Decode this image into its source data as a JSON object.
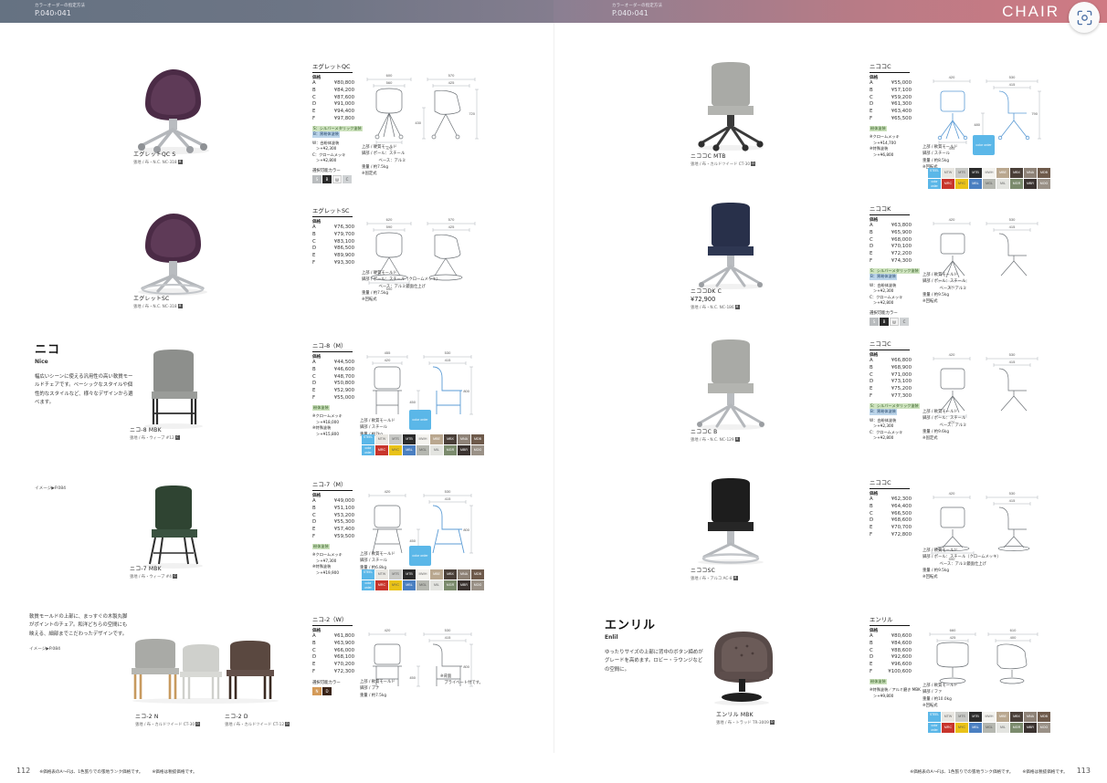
{
  "banner": {
    "left_note_small": "カラーオーダーの指定方法",
    "left_note_big": "P.040›041",
    "right_note_small": "カラーオーダーの指定方法",
    "right_note_big": "P.040›041",
    "category": "CHAIR",
    "camera_icon": "scan-camera-icon"
  },
  "labels": {
    "kakaku": "価格",
    "choose_color": "選択可能カラー",
    "joubu": "上部 /",
    "kyakubu": "脚部 /",
    "juuryou": "重量 /",
    "image_ref": "イメージ▶P.084"
  },
  "series": [
    {
      "name": "ニコ",
      "en": "Nice",
      "desc": "幅広いシーンに使える汎用性の高い軟質モールドチェアです。ベーシックなスタイルや個性的なスタイルなど、様々なデザインから選べます。"
    },
    {
      "name": "エンリル",
      "en": "Enlil",
      "desc": "ゆったりサイズの上部に背中のボタン締めがグレードを高めます。ロビー・ラウンジなどの空間に。"
    }
  ],
  "left_margin_note": {
    "text": "軟質モールドの上部に、まっすぐの木製丸脚がポイントのチェア。和洋どちらの空間にも映える、細部までこだわったデザインです。",
    "ref": "イメージ▶P.084"
  },
  "products": [
    {
      "id": "egret-qc",
      "title": "エグレットQC",
      "prices": [
        {
          "rank": "A",
          "value": "¥80,800"
        },
        {
          "rank": "B",
          "value": "¥84,200"
        },
        {
          "rank": "C",
          "value": "¥87,600"
        },
        {
          "rank": "D",
          "value": "¥91,000"
        },
        {
          "rank": "E",
          "value": "¥94,400"
        },
        {
          "rank": "F",
          "value": "¥97,800"
        }
      ],
      "tags": [
        {
          "text": "S：シルバーメタリック塗装",
          "kind": "green"
        },
        {
          "text": "B：黒粉体塗装",
          "kind": "blue"
        }
      ],
      "options": [
        {
          "label": "W：白粉体塗装",
          "add": "＞+¥2,300"
        },
        {
          "label": "C：クロームメッキ",
          "add": "＞+¥2,800"
        }
      ],
      "swatches": [
        {
          "code": "S",
          "color": "#b9bcbe"
        },
        {
          "code": "B",
          "color": "#2a2a2a"
        },
        {
          "code": "W",
          "color": "#f2f2f2",
          "dark": true
        },
        {
          "code": "C",
          "color": "#cfd2d4",
          "dark": true
        }
      ],
      "materials": [
        "上部 / 硬質モールド",
        "脚部 / ポール：スチール",
        "　　　　 ベース：アルミ",
        "重量 / 約7.5kg",
        "※固定式"
      ],
      "dims": {
        "w_out": "600",
        "w_in": "560",
        "d_out": "570",
        "d_in": "425",
        "base": "470",
        "h_total": "720",
        "h_seat": "430",
        "h_back": "90"
      }
    },
    {
      "id": "egret-sc",
      "title": "エグレットSC",
      "prices": [
        {
          "rank": "A",
          "value": "¥76,300"
        },
        {
          "rank": "B",
          "value": "¥79,700"
        },
        {
          "rank": "C",
          "value": "¥83,100"
        },
        {
          "rank": "D",
          "value": "¥86,500"
        },
        {
          "rank": "E",
          "value": "¥89,900"
        },
        {
          "rank": "F",
          "value": "¥93,300"
        }
      ],
      "tags": [],
      "options": [],
      "swatches": [],
      "materials": [
        "上部 / 硬質モールド",
        "脚部 / ポール：スチール（クロームメッキ）",
        "　　　　 ベース：アルミ鏡面仕上げ",
        "重量 / 約7.5kg",
        "※回転式"
      ],
      "dims": {
        "w_out": "620",
        "w_in": "590",
        "d_out": "570",
        "d_in": "425",
        "base": "590",
        "h_total": "720",
        "h_seat": "430",
        "h_back": "90"
      }
    },
    {
      "id": "nico-8m",
      "title": "ニコ-8（M）",
      "prices": [
        {
          "rank": "A",
          "value": "¥44,500"
        },
        {
          "rank": "B",
          "value": "¥46,600"
        },
        {
          "rank": "C",
          "value": "¥48,700"
        },
        {
          "rank": "D",
          "value": "¥50,800"
        },
        {
          "rank": "E",
          "value": "¥52,900"
        },
        {
          "rank": "F",
          "value": "¥55,000"
        }
      ],
      "tags": [
        {
          "text": "粉体塗装",
          "kind": "green"
        }
      ],
      "options": [
        {
          "label": "※クロームメッキ",
          "add": "＞+¥18,000"
        },
        {
          "label": "※特殊塗装",
          "add": "＞+¥15,800"
        }
      ],
      "swatches": [],
      "materials": [
        "上部 / 軟質モールド",
        "脚部 / スチール",
        "重量 / 約7kg"
      ],
      "dims": {
        "w_out": "455",
        "w_in": "420",
        "d_out": "530",
        "d_in": "415",
        "base": "",
        "h_total": "800",
        "h_seat": "450",
        "h_back": ""
      },
      "has_palette": true
    },
    {
      "id": "nico-7m",
      "title": "ニコ-7（M）",
      "prices": [
        {
          "rank": "A",
          "value": "¥49,000"
        },
        {
          "rank": "B",
          "value": "¥51,100"
        },
        {
          "rank": "C",
          "value": "¥53,200"
        },
        {
          "rank": "D",
          "value": "¥55,300"
        },
        {
          "rank": "E",
          "value": "¥57,400"
        },
        {
          "rank": "F",
          "value": "¥59,500"
        }
      ],
      "tags": [
        {
          "text": "粉体塗装",
          "kind": "green"
        }
      ],
      "options": [
        {
          "label": "※クロームメッキ",
          "add": "＞+¥7,300"
        },
        {
          "label": "※特殊塗装",
          "add": "＞+¥19,900"
        }
      ],
      "swatches": [],
      "materials": [
        "上部 / 軟質モールド",
        "脚部 / スチール",
        "重量 / 約6.8kg"
      ],
      "dims": {
        "w_out": "420",
        "w_in": "",
        "d_out": "530",
        "d_in": "415",
        "base": "",
        "h_total": "800",
        "h_seat": "450",
        "h_back": ""
      },
      "has_palette": true
    },
    {
      "id": "nico-2w",
      "title": "ニコ-2（W）",
      "prices": [
        {
          "rank": "A",
          "value": "¥61,800"
        },
        {
          "rank": "B",
          "value": "¥63,900"
        },
        {
          "rank": "C",
          "value": "¥66,000"
        },
        {
          "rank": "D",
          "value": "¥68,100"
        },
        {
          "rank": "E",
          "value": "¥70,200"
        },
        {
          "rank": "F",
          "value": "¥72,300"
        }
      ],
      "tags": [],
      "options": [],
      "swatches": [
        {
          "code": "N",
          "color": "#d49a58"
        },
        {
          "code": "D",
          "color": "#3a2418"
        }
      ],
      "materials": [
        "上部 / 軟質モールド",
        "脚部 / ブナ",
        "重量 / 約7.5kg"
      ],
      "note": "※背面\n　プライベート付です。",
      "dims": {
        "w_out": "420",
        "w_in": "",
        "d_out": "530",
        "d_in": "415",
        "base": "",
        "h_total": "800",
        "h_seat": "450",
        "h_back": ""
      }
    },
    {
      "id": "nicoco-cc",
      "title": "ニココC",
      "prices": [
        {
          "rank": "A",
          "value": "¥55,000"
        },
        {
          "rank": "B",
          "value": "¥57,100"
        },
        {
          "rank": "C",
          "value": "¥59,200"
        },
        {
          "rank": "D",
          "value": "¥61,300"
        },
        {
          "rank": "E",
          "value": "¥63,400"
        },
        {
          "rank": "F",
          "value": "¥65,500"
        }
      ],
      "tags": [
        {
          "text": "粉体塗装",
          "kind": "green"
        }
      ],
      "options": [
        {
          "label": "※クロームメッキ",
          "add": "＞+¥14,700"
        },
        {
          "label": "※特殊塗装",
          "add": "＞+¥6,800"
        }
      ],
      "swatches": [],
      "materials": [
        "上部 / 軟質モールド",
        "脚部 / スチール",
        "重量 / 約8.5kg",
        "※回転式"
      ],
      "dims": {
        "w_out": "420",
        "w_in": "",
        "d_out": "530",
        "d_in": "415",
        "base": "495",
        "h_total": "790",
        "h_seat": "480",
        "h_back": ""
      },
      "has_palette": true
    },
    {
      "id": "nicoco-dk",
      "title": "ニココK",
      "prices": [
        {
          "rank": "A",
          "value": "¥63,800"
        },
        {
          "rank": "B",
          "value": "¥65,900"
        },
        {
          "rank": "C",
          "value": "¥68,000"
        },
        {
          "rank": "D",
          "value": "¥70,100"
        },
        {
          "rank": "E",
          "value": "¥72,200"
        },
        {
          "rank": "F",
          "value": "¥74,300"
        }
      ],
      "tags": [
        {
          "text": "S：シルバーメタリック塗装",
          "kind": "green"
        },
        {
          "text": "B：黒粉体塗装",
          "kind": "blue"
        }
      ],
      "options": [
        {
          "label": "W：白粉体塗装",
          "add": "＞+¥2,300"
        },
        {
          "label": "C：クロームメッキ",
          "add": "＞+¥2,800"
        }
      ],
      "swatches": [
        {
          "code": "S",
          "color": "#b9bcbe"
        },
        {
          "code": "B",
          "color": "#2a2a2a"
        },
        {
          "code": "W",
          "color": "#f2f2f2",
          "dark": true
        },
        {
          "code": "C",
          "color": "#cfd2d4",
          "dark": true
        }
      ],
      "materials": [
        "上部 / 軟質モールド",
        "脚部 / ポール：スチール",
        "　　　　 ベース：アルミ",
        "重量 / 約9.5kg",
        "※回転式"
      ],
      "dims": {
        "w_out": "420",
        "w_in": "",
        "d_out": "530",
        "d_in": "415",
        "base": "470",
        "h_total": "790",
        "h_seat": "480",
        "h_back": ""
      }
    },
    {
      "id": "nicoco-qc",
      "title": "ニココC",
      "prices": [
        {
          "rank": "A",
          "value": "¥66,800"
        },
        {
          "rank": "B",
          "value": "¥68,900"
        },
        {
          "rank": "C",
          "value": "¥71,000"
        },
        {
          "rank": "D",
          "value": "¥73,100"
        },
        {
          "rank": "E",
          "value": "¥75,200"
        },
        {
          "rank": "F",
          "value": "¥77,300"
        }
      ],
      "tags": [
        {
          "text": "S：シルバーメタリック塗装",
          "kind": "green"
        },
        {
          "text": "B：黒粉体塗装",
          "kind": "blue"
        }
      ],
      "options": [
        {
          "label": "W：白粉体塗装",
          "add": "＞+¥2,300"
        },
        {
          "label": "C：クロームメッキ",
          "add": "＞+¥2,800"
        }
      ],
      "swatches": [],
      "materials": [
        "上部 / 軟質モールド",
        "脚部 / ポール：スチール",
        "　　　　 ベース：アルミ",
        "重量 / 約9.6kg",
        "※固定式"
      ],
      "dims": {
        "w_out": "420",
        "w_in": "",
        "d_out": "530",
        "d_in": "415",
        "base": "470",
        "h_total": "790",
        "h_seat": "480",
        "h_back": ""
      }
    },
    {
      "id": "nicoco-sc",
      "title": "ニココC",
      "prices": [
        {
          "rank": "A",
          "value": "¥62,300"
        },
        {
          "rank": "B",
          "value": "¥64,400"
        },
        {
          "rank": "C",
          "value": "¥66,500"
        },
        {
          "rank": "D",
          "value": "¥68,600"
        },
        {
          "rank": "E",
          "value": "¥70,700"
        },
        {
          "rank": "F",
          "value": "¥72,800"
        }
      ],
      "tags": [],
      "options": [],
      "swatches": [],
      "materials": [
        "上部 / 軟質モールド",
        "脚部 / ポール：スチール（クロームメッキ）",
        "　　　　 ベース：アルミ鏡面仕上げ",
        "重量 / 約9.5kg",
        "※回転式"
      ],
      "dims": {
        "w_out": "420",
        "w_in": "",
        "d_out": "530",
        "d_in": "415",
        "base": "590",
        "h_total": "790",
        "h_seat": "480",
        "h_back": ""
      }
    },
    {
      "id": "enlil",
      "title": "エンリル",
      "prices": [
        {
          "rank": "A",
          "value": "¥80,600"
        },
        {
          "rank": "B",
          "value": "¥84,600"
        },
        {
          "rank": "C",
          "value": "¥88,600"
        },
        {
          "rank": "D",
          "value": "¥92,600"
        },
        {
          "rank": "E",
          "value": "¥96,600"
        },
        {
          "rank": "F",
          "value": "¥100,600"
        }
      ],
      "tags": [
        {
          "text": "粉体塗装",
          "kind": "green"
        }
      ],
      "options": [
        {
          "label": "※特殊塗装／アルミ磨き MBK",
          "add": "＞+¥9,800"
        }
      ],
      "swatches": [],
      "materials": [
        "上部 / 軟質モールド",
        "脚部 / ファ",
        "重量 / 約10.0kg",
        "※回転式"
      ],
      "dims": {
        "w_out": "660",
        "w_in": "425",
        "d_out": "610",
        "d_in": "400",
        "base": "",
        "h_total": "740",
        "h_seat": "400",
        "h_back": ""
      },
      "has_palette": true
    }
  ],
  "photos": [
    {
      "id": "egret-qc-s",
      "name": "エグレットQC S",
      "fabric": "張地 / 布・N.C. NC-318",
      "grade": "B"
    },
    {
      "id": "egret-sc",
      "name": "エグレットSC",
      "fabric": "張地 / 布・N.C. NC-318",
      "grade": "B"
    },
    {
      "id": "nico-8-mbk",
      "name": "ニコ-8 MBK",
      "fabric": "張地 / 布・ウィーブ #12",
      "grade": "C"
    },
    {
      "id": "nico-7-mbk",
      "name": "ニコ-7 MBK",
      "fabric": "張地 / 布・ウィーブ #4",
      "grade": "C"
    },
    {
      "id": "nico-2-n",
      "name": "ニコ-2 N",
      "fabric": "張地 / 布・カルドツイード CT-30",
      "grade": "D"
    },
    {
      "id": "nico-2-d",
      "name": "ニコ-2 D",
      "fabric": "張地 / 布・カルドツイード CT-12",
      "grade": "D"
    },
    {
      "id": "nicocc-mtb",
      "name": "ニココC MTB",
      "fabric": "張地 / 布・カルドツイード CT-30",
      "grade": "D"
    },
    {
      "id": "nicodk-c",
      "name": "ニココDK C",
      "price": "¥72,900",
      "fabric": "張地 / 布・N.C. NC-186",
      "grade": "B"
    },
    {
      "id": "nicocc-b",
      "name": "ニココC B",
      "fabric": "張地 / 布・N.C. NC-129",
      "grade": "B"
    },
    {
      "id": "nicosc",
      "name": "ニココSC",
      "fabric": "張地 / 布・アルコ AC-8",
      "grade": "B"
    },
    {
      "id": "enlil-mbk",
      "name": "エンリル MBK",
      "fabric": "張地 / 布・トラッド TR-3009",
      "grade": "D"
    }
  ],
  "palette": {
    "steel_label": "STEEL",
    "color_order_label": "color order",
    "chip_label": "color order",
    "row1": [
      {
        "code": "MTW",
        "color": "#e9e7e2",
        "dark": true
      },
      {
        "code": "MTS",
        "color": "#c8c9c6",
        "dark": true
      },
      {
        "code": "MTB",
        "color": "#2b2b2b"
      },
      {
        "code": "MWH",
        "color": "#f4f3ef",
        "dark": true
      },
      {
        "code": "MBE",
        "color": "#b9a78f"
      },
      {
        "code": "MBX",
        "color": "#4a3f38"
      },
      {
        "code": "MNA",
        "color": "#8e8277"
      },
      {
        "code": "MDB",
        "color": "#6e5a4b"
      }
    ],
    "row2": [
      {
        "code": "MRC",
        "color": "#c8352c"
      },
      {
        "code": "MYC",
        "color": "#e9c218"
      },
      {
        "code": "MBL",
        "color": "#4a7fc1"
      },
      {
        "code": "MGL",
        "color": "#b5b7b0",
        "dark": true
      },
      {
        "code": "MIL",
        "color": "#e3e4e0",
        "dark": true
      },
      {
        "code": "MGR",
        "color": "#7b8b6d"
      },
      {
        "code": "MBR",
        "color": "#3b3330"
      },
      {
        "code": "MOG",
        "color": "#9a9187"
      }
    ]
  },
  "footer": {
    "left_page": "112",
    "right_page": "113",
    "note1": "※価格表のA〜Fは、1色張りでの張地ランク価格です。",
    "note2": "※価格は税抜価格です。"
  }
}
